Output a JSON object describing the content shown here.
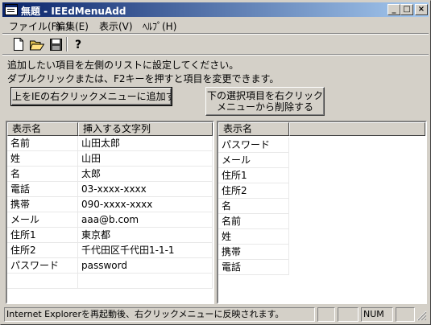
{
  "window": {
    "title": "無題 - IEEdMenuAdd",
    "minimize": "_",
    "maximize": "□",
    "close": "×"
  },
  "menu": [
    "ファイル(F)",
    "編集(E)",
    "表示(V)",
    "ﾍﾙﾌﾟ(H)"
  ],
  "toolbar": {
    "icons": [
      "new-document-icon",
      "open-folder-icon",
      "save-disk-icon",
      "help-icon"
    ]
  },
  "instructions": {
    "line1": "追加したい項目を左側のリストに設定してください。",
    "line2": "ダブルクリックまたは、F2キーを押すと項目を変更できます。"
  },
  "buttons": {
    "add": "上をIEの右クリックメニューに追加する",
    "remove_line1": "下の選択項目を右クリック",
    "remove_line2": "メニューから削除する"
  },
  "left_list": {
    "headers": [
      "表示名",
      "挿入する文字列"
    ],
    "rows": [
      [
        "名前",
        "山田太郎"
      ],
      [
        "姓",
        "山田"
      ],
      [
        "名",
        "太郎"
      ],
      [
        "電話",
        "03-xxxx-xxxx"
      ],
      [
        "携帯",
        "090-xxxx-xxxx"
      ],
      [
        "メール",
        "aaa@b.com"
      ],
      [
        "住所1",
        "東京都"
      ],
      [
        "住所2",
        "千代田区千代田1-1-1"
      ],
      [
        "パスワード",
        "password"
      ],
      [
        "",
        ""
      ]
    ]
  },
  "right_list": {
    "headers": [
      "表示名",
      ""
    ],
    "rows": [
      "パスワード",
      "メール",
      "住所1",
      "住所2",
      "名",
      "名前",
      "姓",
      "携帯",
      "電話"
    ]
  },
  "status": {
    "message": "Internet Explorerを再起動後、右クリックメニューに反映されます。",
    "num": "NUM"
  }
}
